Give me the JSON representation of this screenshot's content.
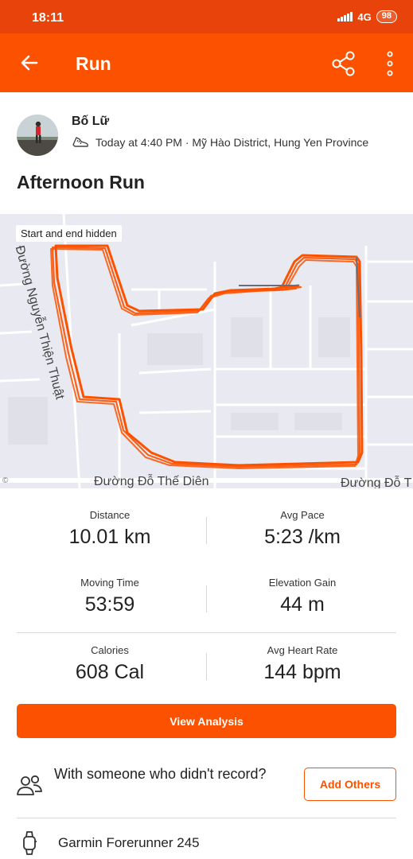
{
  "status_bar": {
    "time": "18:11",
    "network": "4G",
    "battery": "98"
  },
  "app_bar": {
    "title": "Run"
  },
  "athlete": {
    "name": "Bố Lữ",
    "meta": "Today at 4:40 PM · Mỹ Hào District, Hung Yen Province"
  },
  "activity": {
    "title": "Afternoon Run"
  },
  "map": {
    "badge": "Start and end hidden",
    "street_left": "Đường Nguyễn Thiện Thuật",
    "street_bottom": "Đường Đỗ Thế Diên",
    "street_bottom_right": "Đường Đỗ T",
    "route_color": "#fc5200"
  },
  "stats": [
    {
      "label": "Distance",
      "value": "10.01 km"
    },
    {
      "label": "Avg Pace",
      "value": "5:23 /km"
    },
    {
      "label": "Moving Time",
      "value": "53:59"
    },
    {
      "label": "Elevation Gain",
      "value": "44 m"
    },
    {
      "label": "Calories",
      "value": "608 Cal"
    },
    {
      "label": "Avg Heart Rate",
      "value": "144 bpm"
    }
  ],
  "actions": {
    "view_analysis": "View Analysis",
    "with_someone": "With someone who didn't record?",
    "add_others": "Add Others"
  },
  "device": {
    "name": "Garmin Forerunner 245"
  },
  "colors": {
    "brand": "#fc5200",
    "status_bar": "#e8430b"
  }
}
